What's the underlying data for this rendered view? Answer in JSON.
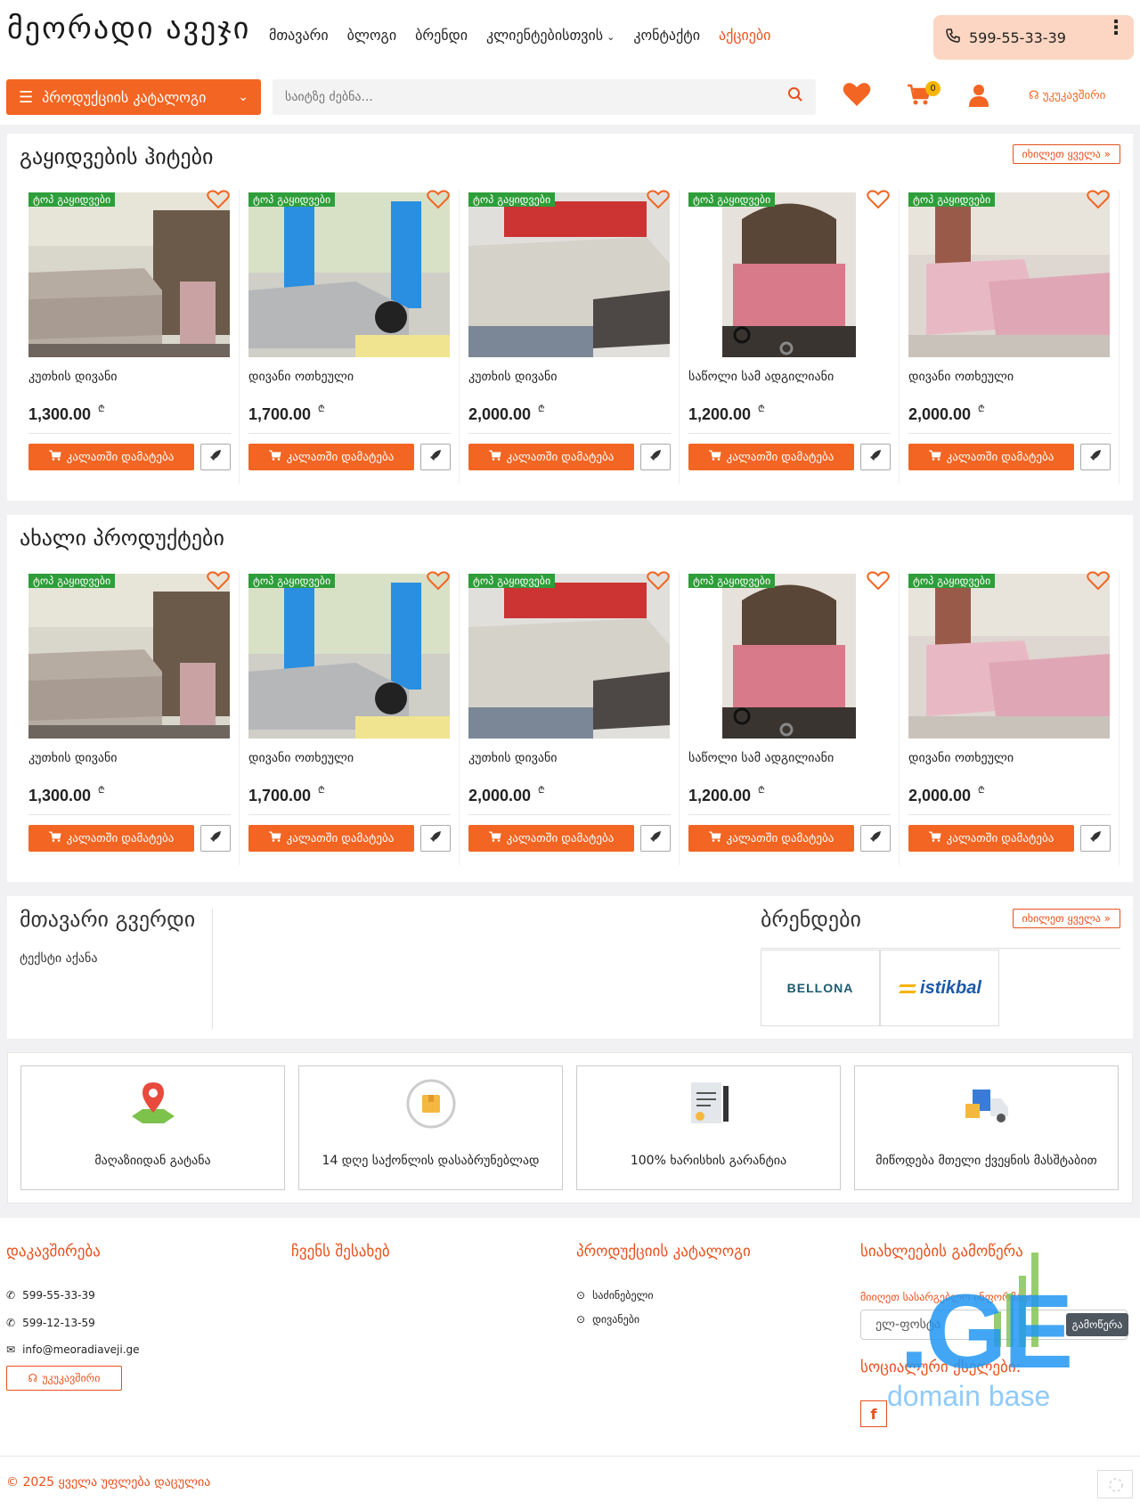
{
  "header": {
    "logo": "მეორადი ავეჯი",
    "nav": [
      "მთავარი",
      "ბლოგი",
      "ბრენდი",
      "კლიენტებისთვის",
      "კონტაქტი",
      "აქციები"
    ],
    "phone": "599-55-33-39",
    "catalog_label": "პროდუქციის კატალოგი",
    "search_placeholder": "საიტზე ძებნა...",
    "cart_count": "0",
    "callback_label": "უკუკავშირი"
  },
  "sections": [
    {
      "title": "გაყიდვების ჰიტები",
      "see_all": "იხილეთ ყველა »",
      "products": [
        {
          "badge": "ტოპ გაყიდვები",
          "name": "კუთხის დივანი",
          "price": "1,300.00",
          "currency": "₾",
          "cart_label": "კალათში დამატება"
        },
        {
          "badge": "ტოპ გაყიდვები",
          "name": "დივანი ოთხეული",
          "price": "1,700.00",
          "currency": "₾",
          "cart_label": "კალათში დამატება"
        },
        {
          "badge": "ტოპ გაყიდვები",
          "name": "კუთხის დივანი",
          "price": "2,000.00",
          "currency": "₾",
          "cart_label": "კალათში დამატება"
        },
        {
          "badge": "ტოპ გაყიდვები",
          "name": "საწოლი სამ ადგილიანი",
          "price": "1,200.00",
          "currency": "₾",
          "cart_label": "კალათში დამატება"
        },
        {
          "badge": "ტოპ გაყიდვები",
          "name": "დივანი ოთხეული",
          "price": "2,000.00",
          "currency": "₾",
          "cart_label": "კალათში დამატება"
        }
      ]
    },
    {
      "title": "ახალი პროდუქტები",
      "see_all": "",
      "products": [
        {
          "badge": "ტოპ გაყიდვები",
          "name": "კუთხის დივანი",
          "price": "1,300.00",
          "currency": "₾",
          "cart_label": "კალათში დამატება"
        },
        {
          "badge": "ტოპ გაყიდვები",
          "name": "დივანი ოთხეული",
          "price": "1,700.00",
          "currency": "₾",
          "cart_label": "კალათში დამატება"
        },
        {
          "badge": "ტოპ გაყიდვები",
          "name": "კუთხის დივანი",
          "price": "2,000.00",
          "currency": "₾",
          "cart_label": "კალათში დამატება"
        },
        {
          "badge": "ტოპ გაყიდვები",
          "name": "საწოლი სამ ადგილიანი",
          "price": "1,200.00",
          "currency": "₾",
          "cart_label": "კალათში დამატება"
        },
        {
          "badge": "ტოპ გაყიდვები",
          "name": "დივანი ოთხეული",
          "price": "2,000.00",
          "currency": "₾",
          "cart_label": "კალათში დამატება"
        }
      ]
    }
  ],
  "home": {
    "title": "მთავარი გვერდი",
    "text": "ტექსტი აქანა",
    "brands_title": "ბრენდები",
    "brands_see_all": "იხილეთ ყველა »",
    "brands": [
      "BELLONA",
      "istikbal"
    ]
  },
  "features": [
    "მაღაზიიდან გატანა",
    "14 დღე საქონლის დასაბრუნებლად",
    "100% ხარისხის გარანტია",
    "მიწოდება მთელი ქვეყნის მასშტაბით"
  ],
  "footer": {
    "contact_title": "დაკავშირება",
    "phones": [
      "599-55-33-39",
      "599-12-13-59"
    ],
    "email": "info@meoradiaveji.ge",
    "callback_label": "უკუკავშირი",
    "about_title": "ჩვენს შესახებ",
    "catalog_title": "პროდუქციის კატალოგი",
    "catalog_items": [
      "საძინებელი",
      "დივანები"
    ],
    "news_title": "სიახლეების გამოწერა",
    "news_note": "მიიღეთ სასარგებლო ინფორმაცია",
    "email_placeholder": "ელ-ფოსტა",
    "subscribe_label": "გამოწერა",
    "social_title": "სოციალური ქსელები:",
    "copyright": "© 2025 ყველა უფლება დაცულია",
    "watermark_ge": ".GE",
    "watermark_db": "domain base"
  },
  "colors": {
    "accent": "#f26522",
    "badge": "#2e9e3a",
    "phone_bg": "#fcd6c2"
  }
}
